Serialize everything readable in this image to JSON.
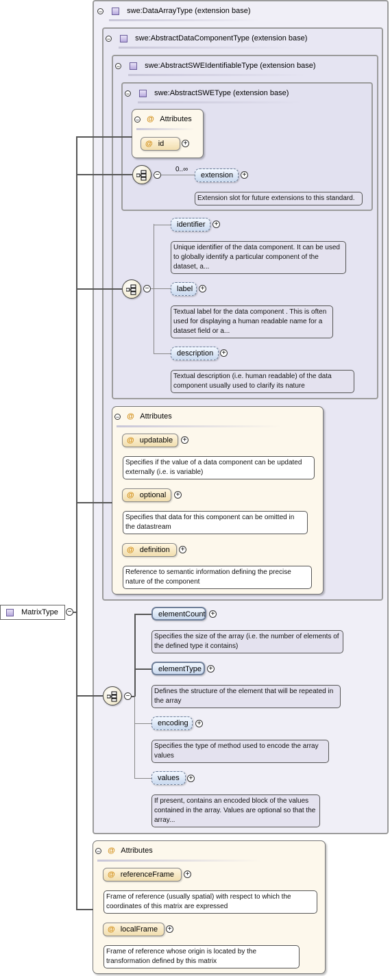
{
  "root": {
    "name": "MatrixType"
  },
  "ext_data_array": {
    "title": "swe:DataArrayType (extension base)"
  },
  "ext_abstract_data_component": {
    "title": "swe:AbstractDataComponentType (extension base)"
  },
  "ext_abstract_swe_identifiable": {
    "title": "swe:AbstractSWEIdentifiableType (extension base)"
  },
  "ext_abstract_swe": {
    "title": "swe:AbstractSWEType (extension base)"
  },
  "attr_group_swe": {
    "label": "Attributes",
    "items": [
      {
        "name": "id"
      }
    ]
  },
  "extension_el": {
    "name": "extension",
    "cardinality": "0..∞",
    "doc": "Extension slot for future extensions to this standard."
  },
  "identifiable_seq": {
    "items": [
      {
        "name": "identifier",
        "doc": "Unique identifier of the data component. It can be used to globally identify a particular component of the dataset, a..."
      },
      {
        "name": "label",
        "doc": "Textual label for the data component . This is often used for displaying a human readable name for a dataset field or a..."
      },
      {
        "name": "description",
        "doc": "Textual description (i.e. human readable) of the data component usually used to clarify its nature"
      }
    ]
  },
  "attr_group_component": {
    "label": "Attributes",
    "items": [
      {
        "name": "updatable",
        "doc": "Specifies if the value of a data component can be updated externally (i.e. is variable)"
      },
      {
        "name": "optional",
        "doc": "Specifies that data for this component can be omitted in the datastream"
      },
      {
        "name": "definition",
        "doc": "Reference to semantic information defining the precise nature of the component"
      }
    ]
  },
  "array_seq": {
    "items": [
      {
        "name": "elementCount",
        "doc": "Specifies the size of the array (i.e. the number of elements of the defined type it contains)"
      },
      {
        "name": "elementType",
        "doc": "Defines the structure of the element that will be repeated in the array"
      },
      {
        "name": "encoding",
        "doc": "Specifies the type of method used to encode the array values"
      },
      {
        "name": "values",
        "doc": "If present, contains an encoded block of the values contained in the array. Values are optional so that the array..."
      }
    ]
  },
  "attr_group_matrix": {
    "label": "Attributes",
    "items": [
      {
        "name": "referenceFrame",
        "doc": "Frame of reference (usually spatial) with respect to which the coordinates of this matrix are expressed"
      },
      {
        "name": "localFrame",
        "doc": "Frame of reference whose origin is located by the transformation defined by this matrix"
      }
    ]
  },
  "symbols": {
    "minus": "−",
    "plus": "+",
    "at": "@"
  },
  "colors": {
    "element_fill": "#c9d9ef",
    "attribute_fill": "#f1deae",
    "doc_fill": "#e4e2ef",
    "extension_fill": "#e8e7f3"
  }
}
